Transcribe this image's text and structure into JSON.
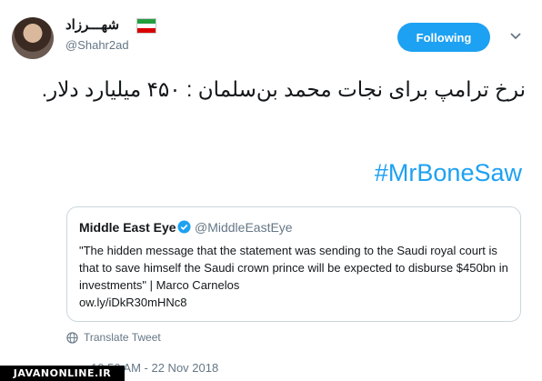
{
  "author": {
    "display_name": "شهـــرزاد",
    "handle": "@Shahr2ad"
  },
  "follow_button": {
    "label": "Following"
  },
  "tweet": {
    "text": "نرخ ترامپ برای نجات محمد بن‌سلمان : ۴۵۰ میلیارد دلار.",
    "hashtag": "#MrBoneSaw"
  },
  "quoted_tweet": {
    "name": "Middle East Eye",
    "handle": "@MiddleEastEye",
    "text": "\"The hidden message that the statement was sending to the Saudi royal court is that to save himself the Saudi crown prince will be expected to disburse $450bn in investments\" | Marco Carnelos",
    "link": "ow.ly/iDkR30mHNc8"
  },
  "translate_label": "Translate Tweet",
  "timestamp": "10:56 AM - 22 Nov 2018",
  "watermark": "JAVANONLINE.IR",
  "colors": {
    "accent": "#1da1f2",
    "muted": "#657786"
  },
  "icons": [
    "iran-flag-icon",
    "chevron-down-icon",
    "verified-icon",
    "globe-icon"
  ]
}
